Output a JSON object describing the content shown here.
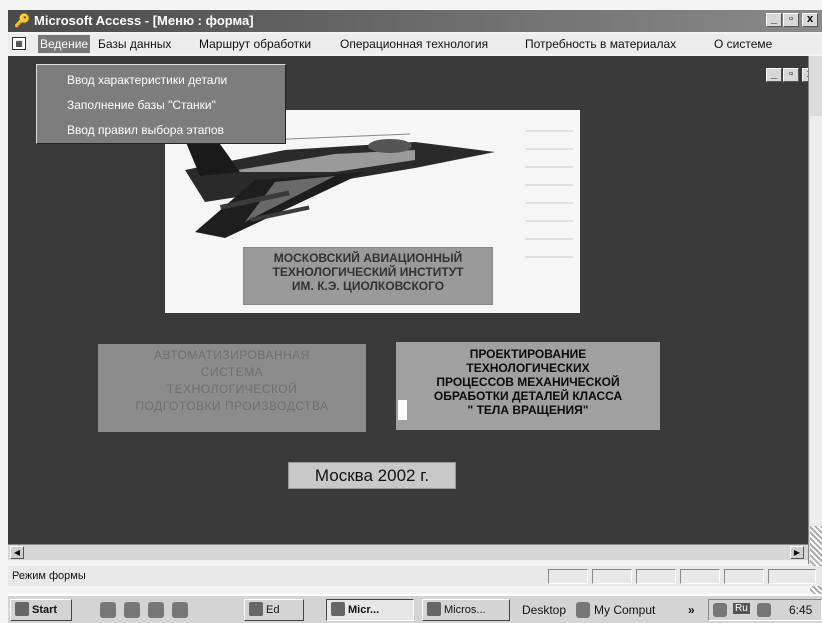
{
  "window": {
    "title": "Microsoft Access - [Меню : форма]",
    "minimize_glyph": "_",
    "restore_glyph": "▫",
    "close_glyph": "x"
  },
  "menubar": {
    "items": [
      "Ведение",
      "Базы данных",
      "Маршрут обработки",
      "Операционная технология",
      "Потребность в материалах",
      "О системе"
    ]
  },
  "dropdown": {
    "items": [
      "Ввод характеристики детали",
      "Заполнение базы \"Станки\"",
      "Ввод правил выбора этапов"
    ]
  },
  "form": {
    "institute_lines": [
      "МОСКОВСКИЙ АВИАЦИОННЫЙ",
      "ТЕХНОЛОГИЧЕСКИЙ ИНСТИТУТ",
      "ИМ. К.Э. ЦИОЛКОВСКОГО"
    ],
    "left_box_lines": [
      "АВТОМАТИЗИРОВАННАЯ",
      "СИСТЕМА",
      "ТЕХНОЛОГИЧЕСКОЙ",
      "ПОДГОТОВКИ ПРОИЗВОДСТВА"
    ],
    "right_box_lines": [
      "ПРОЕКТИРОВАНИЕ",
      "ТЕХНОЛОГИЧЕСКИХ",
      "ПРОЦЕССОВ МЕХАНИЧЕСКОЙ",
      "ОБРАБОТКИ ДЕТАЛЕЙ КЛАССА",
      "\" ТЕЛА ВРАЩЕНИЯ\""
    ],
    "city_year": "Москва 2002 г."
  },
  "statusbar": {
    "mode": "Режим формы"
  },
  "taskbar": {
    "start": "Start",
    "buttons": [
      "Ed",
      "Micr...",
      "Micros..."
    ],
    "desktop": "Desktop",
    "my_computer": "My Comput",
    "chevron": "»",
    "lang": "Ru",
    "clock": "6:45"
  },
  "colors": {
    "form_background": "#3a3a3a",
    "titlebar": "#4a4a4a",
    "menu_highlight": "#777777"
  }
}
